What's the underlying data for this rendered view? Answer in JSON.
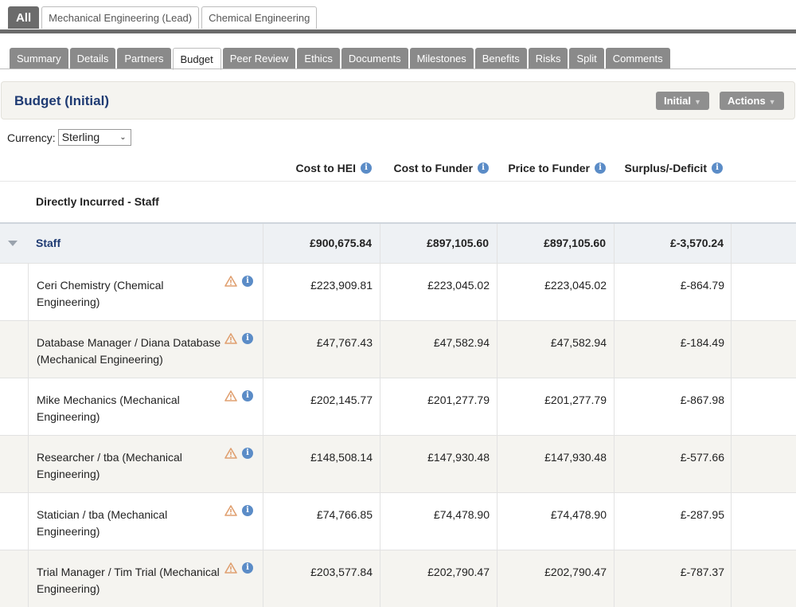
{
  "top_tabs": [
    {
      "label": "All",
      "active": true
    },
    {
      "label": "Mechanical Engineering (Lead)",
      "active": false
    },
    {
      "label": "Chemical Engineering",
      "active": false
    }
  ],
  "sub_tabs": [
    {
      "label": "Summary",
      "active": false
    },
    {
      "label": "Details",
      "active": false
    },
    {
      "label": "Partners",
      "active": false
    },
    {
      "label": "Budget",
      "active": true
    },
    {
      "label": "Peer Review",
      "active": false
    },
    {
      "label": "Ethics",
      "active": false
    },
    {
      "label": "Documents",
      "active": false
    },
    {
      "label": "Milestones",
      "active": false
    },
    {
      "label": "Benefits",
      "active": false
    },
    {
      "label": "Risks",
      "active": false
    },
    {
      "label": "Split",
      "active": false
    },
    {
      "label": "Comments",
      "active": false
    }
  ],
  "panel": {
    "title": "Budget (Initial)",
    "initial_button": "Initial",
    "actions_button": "Actions"
  },
  "currency": {
    "label": "Currency:",
    "selected": "Sterling"
  },
  "columns": [
    "Cost to HEI",
    "Cost to Funder",
    "Price to Funder",
    "Surplus/-Deficit"
  ],
  "section_title": "Directly Incurred - Staff",
  "group": {
    "name": "Staff",
    "values": [
      "£900,675.84",
      "£897,105.60",
      "£897,105.60",
      "£-3,570.24"
    ]
  },
  "rows": [
    {
      "name": "Ceri Chemistry (Chemical Engineering)",
      "values": [
        "£223,909.81",
        "£223,045.02",
        "£223,045.02",
        "£-864.79"
      ]
    },
    {
      "name": "Database Manager / Diana Database (Mechanical Engineering)",
      "values": [
        "£47,767.43",
        "£47,582.94",
        "£47,582.94",
        "£-184.49"
      ]
    },
    {
      "name": "Mike Mechanics (Mechanical Engineering)",
      "values": [
        "£202,145.77",
        "£201,277.79",
        "£201,277.79",
        "£-867.98"
      ]
    },
    {
      "name": "Researcher / tba (Mechanical Engineering)",
      "values": [
        "£148,508.14",
        "£147,930.48",
        "£147,930.48",
        "£-577.66"
      ]
    },
    {
      "name": "Statician / tba (Mechanical Engineering)",
      "values": [
        "£74,766.85",
        "£74,478.90",
        "£74,478.90",
        "£-287.95"
      ]
    },
    {
      "name": "Trial Manager / Tim Trial (Mechanical Engineering)",
      "values": [
        "£203,577.84",
        "£202,790.47",
        "£202,790.47",
        "£-787.37"
      ]
    }
  ],
  "colors": {
    "accent": "#1f3b73",
    "info_icon": "#5b8cc7",
    "warning_icon": "#e0a070",
    "tab_grey": "#8a8a8a"
  }
}
